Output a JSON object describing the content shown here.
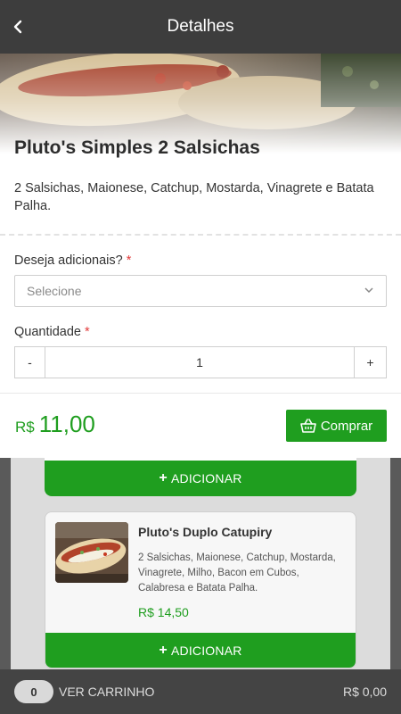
{
  "header": {
    "title": "Detalhes"
  },
  "product": {
    "name": "Pluto's Simples 2 Salsichas",
    "description": "2 Salsichas, Maionese, Catchup, Mostarda, Vinagrete e Batata Palha.",
    "price_currency": "R$",
    "price_value": "11,00"
  },
  "options": {
    "addons_label": "Deseja adicionais?",
    "addons_placeholder": "Selecione",
    "quantity_label": "Quantidade",
    "required_mark": "*",
    "quantity_minus": "-",
    "quantity_value": "1",
    "quantity_plus": "+"
  },
  "buy_button": {
    "label": "Comprar"
  },
  "background_list": {
    "add_label": "ADICIONAR",
    "plus": "+",
    "items": [
      {
        "name": "Pluto's Duplo Catupiry",
        "description": "2 Salsichas, Maionese, Catchup, Mostarda, Vinagrete, Milho, Bacon em Cubos, Calabresa e Batata Palha.",
        "price": "R$ 14,50",
        "image_caption": "Pluto's Duplo Catupiry"
      }
    ]
  },
  "cart": {
    "count": "0",
    "label": "VER CARRINHO",
    "total": "R$ 0,00"
  },
  "colors": {
    "accent": "#1f9e1f",
    "header": "#3d3d3d",
    "required": "#e23b3b"
  }
}
